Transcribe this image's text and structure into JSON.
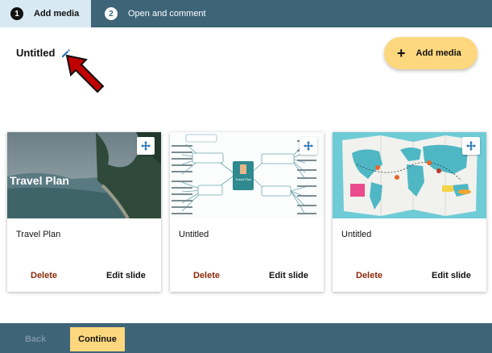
{
  "steps": [
    {
      "number": "1",
      "label": "Add media"
    },
    {
      "number": "2",
      "label": "Open and comment"
    }
  ],
  "header": {
    "title": "Untitled",
    "add_media_label": "Add media"
  },
  "cards": [
    {
      "thumb_text": "Travel Plan",
      "title": "Travel Plan",
      "delete_label": "Delete",
      "edit_label": "Edit slide"
    },
    {
      "thumb_text": "Travel Plan",
      "title": "Untitled",
      "delete_label": "Delete",
      "edit_label": "Edit slide"
    },
    {
      "thumb_text": "",
      "title": "Untitled",
      "delete_label": "Delete",
      "edit_label": "Edit slide"
    }
  ],
  "footer": {
    "back_label": "Back",
    "continue_label": "Continue"
  },
  "colors": {
    "bar": "#3e6478",
    "active_step": "#d8e9f3",
    "accent": "#fcd77e",
    "delete": "#8a2a0a",
    "pencil": "#1f6fb5",
    "arrow": "#c00000"
  }
}
